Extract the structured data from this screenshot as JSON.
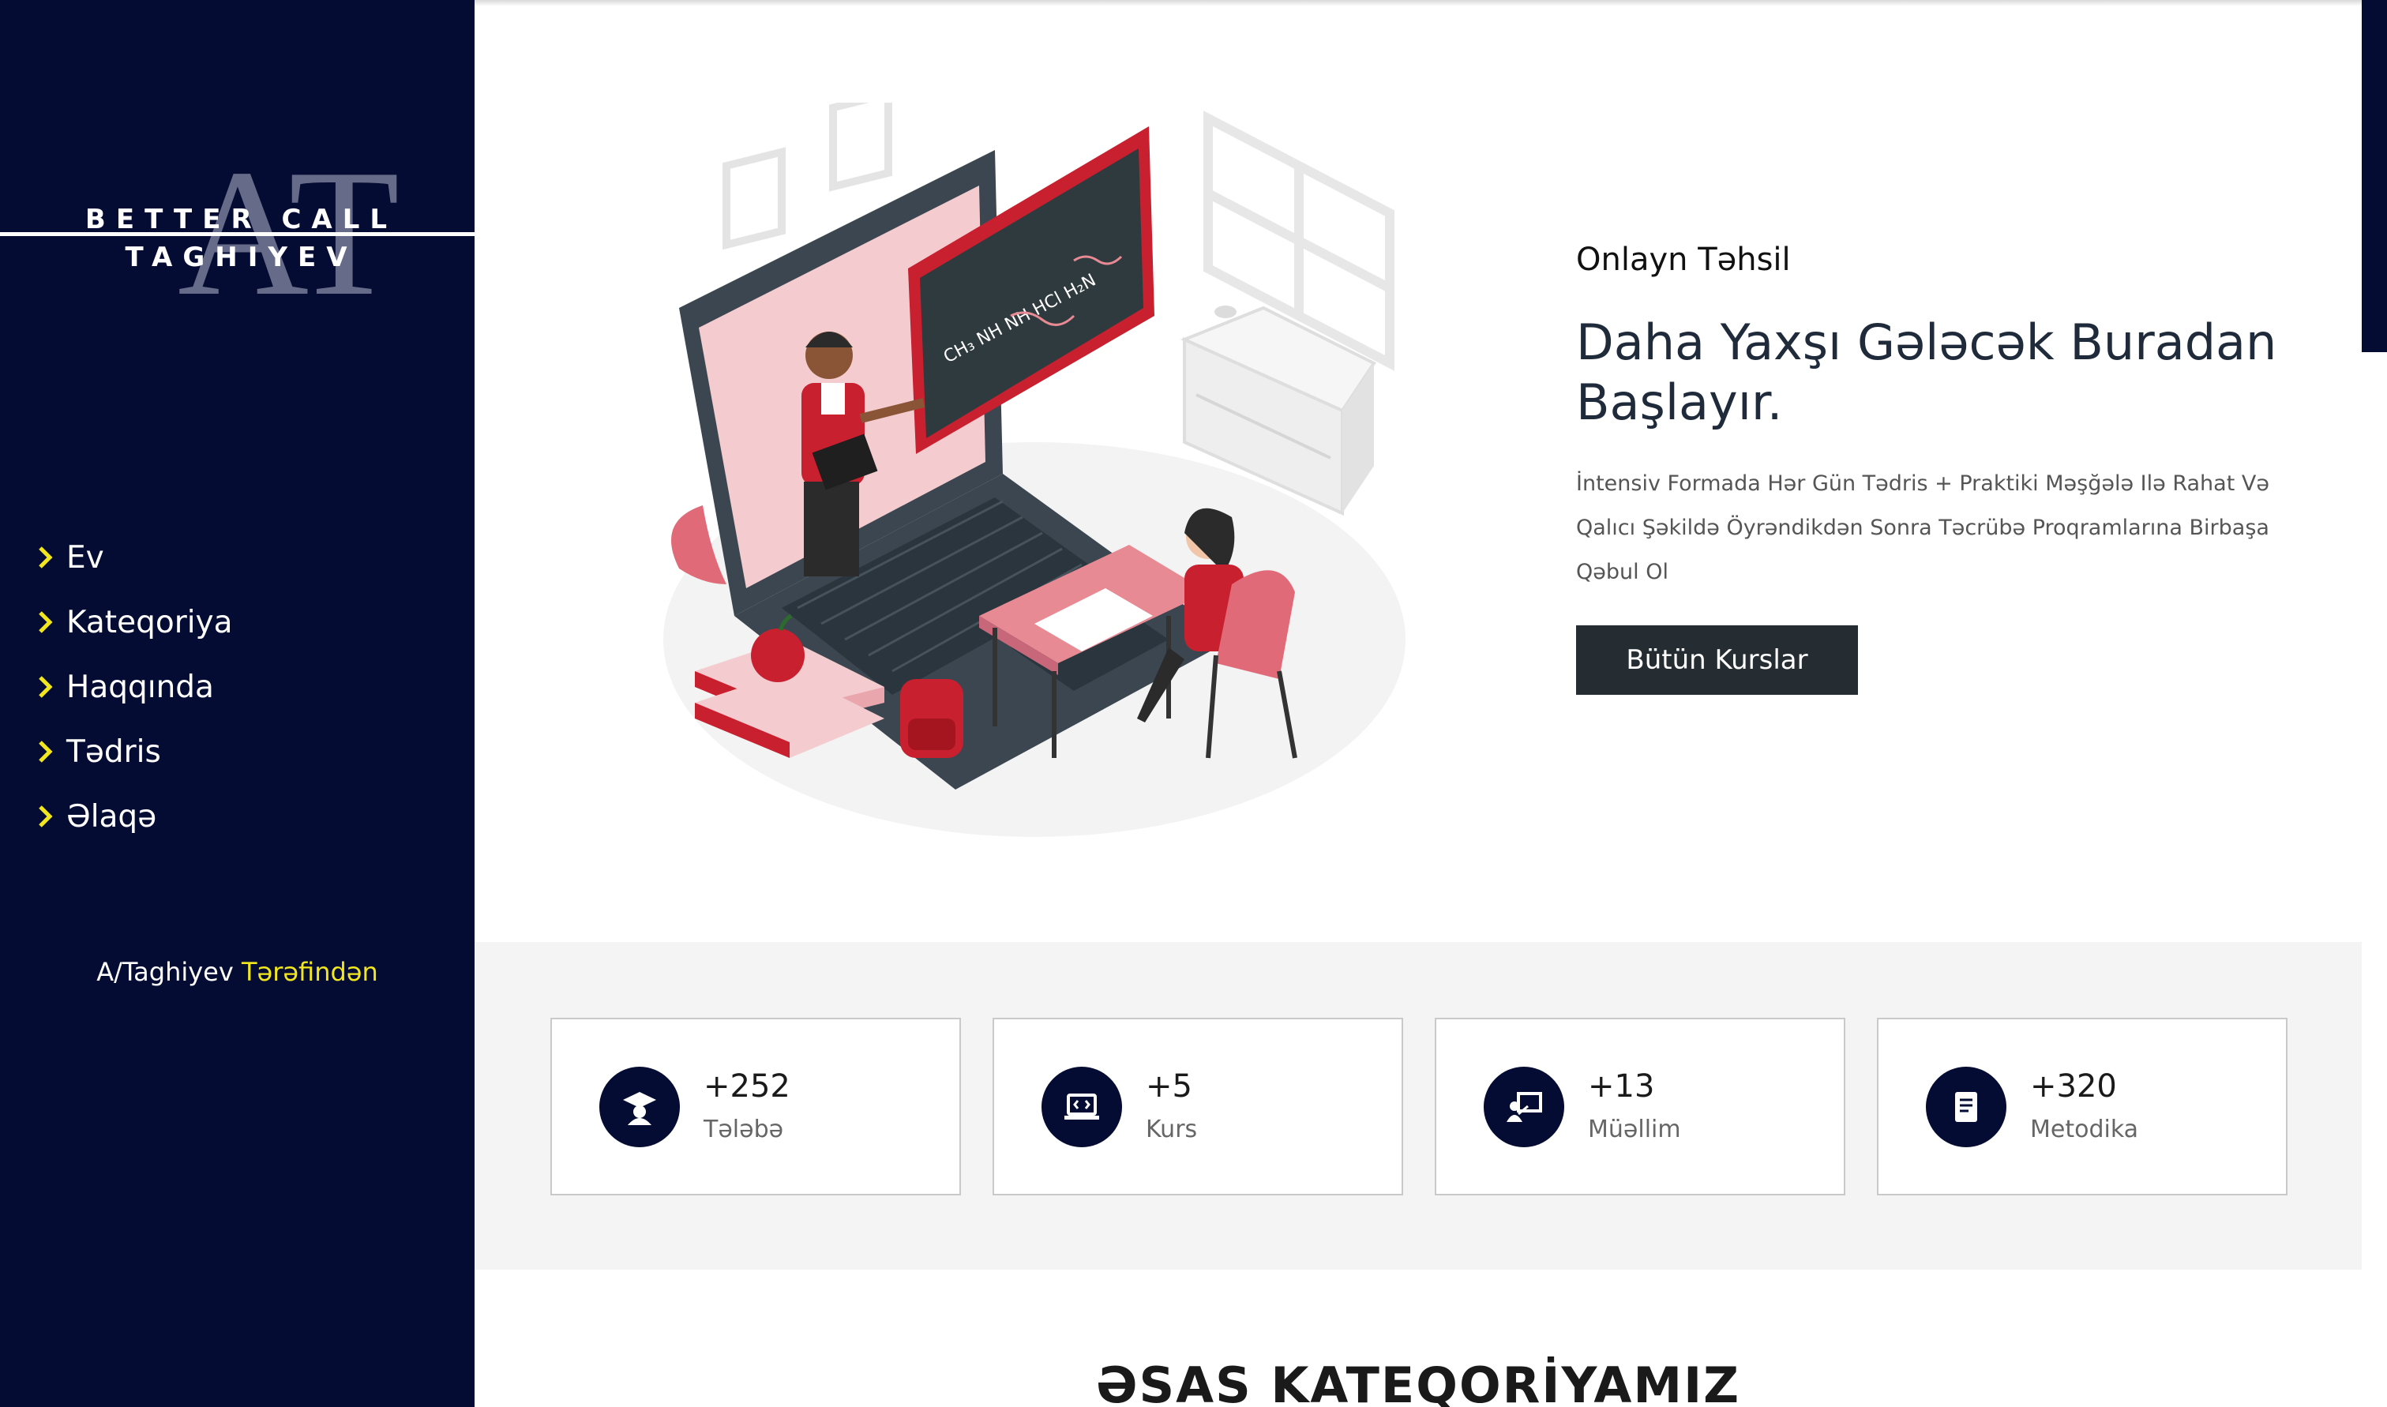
{
  "sidebar": {
    "logo": {
      "line1": "BETTER CALL",
      "line2": "TAGHIYEV",
      "monogram": "AT"
    },
    "items": [
      {
        "label": "Ev"
      },
      {
        "label": "Kateqoriya"
      },
      {
        "label": "Haqqında"
      },
      {
        "label": "Tədris"
      },
      {
        "label": "Əlaqə"
      }
    ],
    "credit": {
      "author": "A/Taghiyev",
      "suffix": "Tərəfindən"
    }
  },
  "hero": {
    "eyebrow": "Onlayn Təhsil",
    "headline": "Daha Yaxşı Gələcək Buradan Başlayır.",
    "subtitle": "İntensiv Formada Hər Gün Tədris + Praktiki Məşğələ Ilə Rahat Və Qalıcı Şəkildə Öyrəndikdən Sonra Təcrübə Proqramlarına Birbaşa Qəbul Ol",
    "cta_label": "Bütün Kurslar",
    "chalkboard_formula": "CH₃ NH NH HCl H₂N"
  },
  "stats": [
    {
      "value": "+252",
      "label": "Tələbə",
      "icon": "graduate-icon"
    },
    {
      "value": "+5",
      "label": "Kurs",
      "icon": "laptop-code-icon"
    },
    {
      "value": "+13",
      "label": "Müəllim",
      "icon": "teacher-board-icon"
    },
    {
      "value": "+320",
      "label": "Metodika",
      "icon": "book-icon"
    }
  ],
  "section": {
    "title": "ƏSAS KATEQORİYAMIZ"
  },
  "colors": {
    "sidebar_bg": "#050c33",
    "accent_yellow": "#f2e71c",
    "button_bg": "#252d33",
    "stats_band_bg": "#f4f4f4",
    "illustration_red": "#c8202f"
  }
}
